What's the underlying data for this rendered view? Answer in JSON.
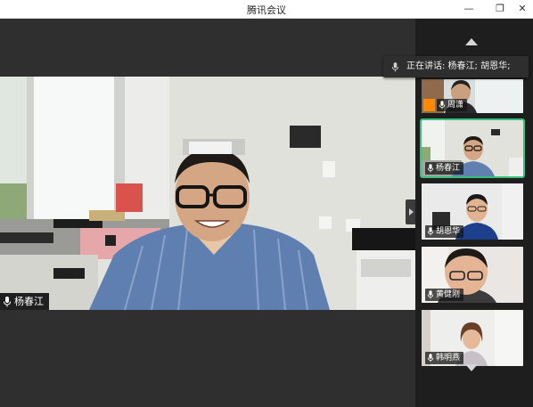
{
  "window": {
    "title": "腾讯会议",
    "minimize_glyph": "—",
    "restore_glyph": "❐",
    "close_glyph": "✕"
  },
  "main": {
    "speaker_name": "杨春江"
  },
  "tooltip": {
    "text": "正在讲话: 杨春江; 胡恩华;"
  },
  "participants": [
    {
      "name": "周潇",
      "host": true,
      "active": false
    },
    {
      "name": "杨春江",
      "host": false,
      "active": true
    },
    {
      "name": "胡恩华",
      "host": false,
      "active": false
    },
    {
      "name": "黄健刚",
      "host": false,
      "active": false
    },
    {
      "name": "韩明燕",
      "host": false,
      "active": false
    }
  ],
  "colors": {
    "accent_active": "#38c07a",
    "host_badge": "#ff8a00"
  },
  "icons": {
    "mic": "microphone-icon",
    "scroll_up": "triangle-up-icon",
    "scroll_down": "triangle-down-icon"
  }
}
